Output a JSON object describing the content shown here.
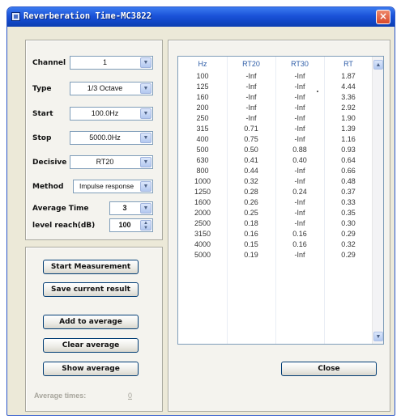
{
  "window": {
    "title": "Reverberation Time-MC3822",
    "close_glyph": "×"
  },
  "settings": {
    "channel": {
      "label": "Channel",
      "value": "1"
    },
    "type": {
      "label": "Type",
      "value": "1/3 Octave"
    },
    "start": {
      "label": "Start",
      "value": "100.0Hz"
    },
    "stop": {
      "label": "Stop",
      "value": "5000.0Hz"
    },
    "decisive": {
      "label": "Decisive",
      "value": "RT20"
    },
    "method": {
      "label": "Method",
      "value": "Impulse response"
    },
    "average_time": {
      "label": "Average Time",
      "value": "3"
    },
    "level_reach": {
      "label": "level reach(dB)",
      "value": "100"
    }
  },
  "actions": {
    "start_measurement": "Start Measurement",
    "save_current_result": "Save current result",
    "add_to_average": "Add to average",
    "clear_average": "Clear average",
    "show_average": "Show average",
    "average_times_label": "Average times:",
    "average_times_value": "0"
  },
  "results": {
    "columns": [
      "Hz",
      "RT20",
      "RT30",
      "RT"
    ],
    "rows": [
      [
        "100",
        "-Inf",
        "-Inf",
        "1.87"
      ],
      [
        "125",
        "-Inf",
        "-Inf",
        "4.44"
      ],
      [
        "160",
        "-Inf",
        "-Inf",
        "3.36"
      ],
      [
        "200",
        "-Inf",
        "-Inf",
        "2.92"
      ],
      [
        "250",
        "-Inf",
        "-Inf",
        "1.90"
      ],
      [
        "315",
        "0.71",
        "-Inf",
        "1.39"
      ],
      [
        "400",
        "0.75",
        "-Inf",
        "1.16"
      ],
      [
        "500",
        "0.50",
        "0.88",
        "0.93"
      ],
      [
        "630",
        "0.41",
        "0.40",
        "0.64"
      ],
      [
        "800",
        "0.44",
        "-Inf",
        "0.66"
      ],
      [
        "1000",
        "0.32",
        "-Inf",
        "0.48"
      ],
      [
        "1250",
        "0.28",
        "0.24",
        "0.37"
      ],
      [
        "1600",
        "0.26",
        "-Inf",
        "0.33"
      ],
      [
        "2000",
        "0.25",
        "-Inf",
        "0.35"
      ],
      [
        "2500",
        "0.18",
        "-Inf",
        "0.30"
      ],
      [
        "3150",
        "0.16",
        "0.16",
        "0.29"
      ],
      [
        "4000",
        "0.15",
        "0.16",
        "0.32"
      ],
      [
        "5000",
        "0.19",
        "-Inf",
        "0.29"
      ]
    ],
    "close_button": "Close"
  },
  "icons": {
    "dropdown": "chevron-down-icon",
    "spin": "spinner-arrows-icon",
    "scroll_up": "scroll-up-icon",
    "scroll_down": "scroll-down-icon"
  },
  "colors": {
    "titlebar": "#1a52d8",
    "header_text": "#2f5ea8",
    "disabled_text": "#a7a59c"
  }
}
